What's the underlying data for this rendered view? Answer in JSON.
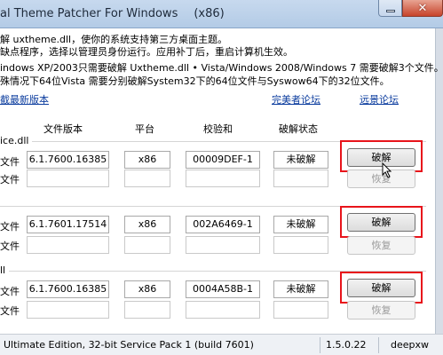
{
  "window": {
    "title": "al Theme Patcher For Windows",
    "arch": "(x86)"
  },
  "info": {
    "line1": "解 uxtheme.dll，使你的系统支持第三方桌面主题。",
    "line2": "缺点程序，选择以管理员身份运行。应用补丁后，重启计算机生效。",
    "line3": "indows XP/2003只需要破解 Uxtheme.dll • Vista/Windows 2008/Windows 7 需要破解3个文件。",
    "line4": "殊情况下64位Vista 需要分别破解System32下的64位文件与Syswow64下的32位文件。"
  },
  "links": {
    "download": "截最新版本",
    "forum1": "完美者论坛",
    "forum2": "远景论坛"
  },
  "columns": {
    "version": "文件版本",
    "platform": "平台",
    "checksum": "校验和",
    "status": "破解状态"
  },
  "row_labels": {
    "current": "文件",
    "backup": "文件"
  },
  "groups": [
    {
      "label": "ice.dll",
      "version": "6.1.7600.16385",
      "platform": "x86",
      "checksum": "00009DEF-1",
      "status": "未破解",
      "patch": "破解",
      "restore": "恢复"
    },
    {
      "label": "",
      "version": "6.1.7601.17514",
      "platform": "x86",
      "checksum": "002A6469-1",
      "status": "未破解",
      "patch": "破解",
      "restore": "恢复"
    },
    {
      "label": "ll",
      "version": "6.1.7600.16385",
      "platform": "x86",
      "checksum": "0004A58B-1",
      "status": "未破解",
      "patch": "破解",
      "restore": "恢复"
    }
  ],
  "status_bar": {
    "os": "Ultimate Edition, 32-bit Service Pack 1 (build 7601)",
    "version": "1.5.0.22",
    "author": "deepxw"
  },
  "colors": {
    "highlight": "#e8141b",
    "link": "#0b3c9e"
  }
}
